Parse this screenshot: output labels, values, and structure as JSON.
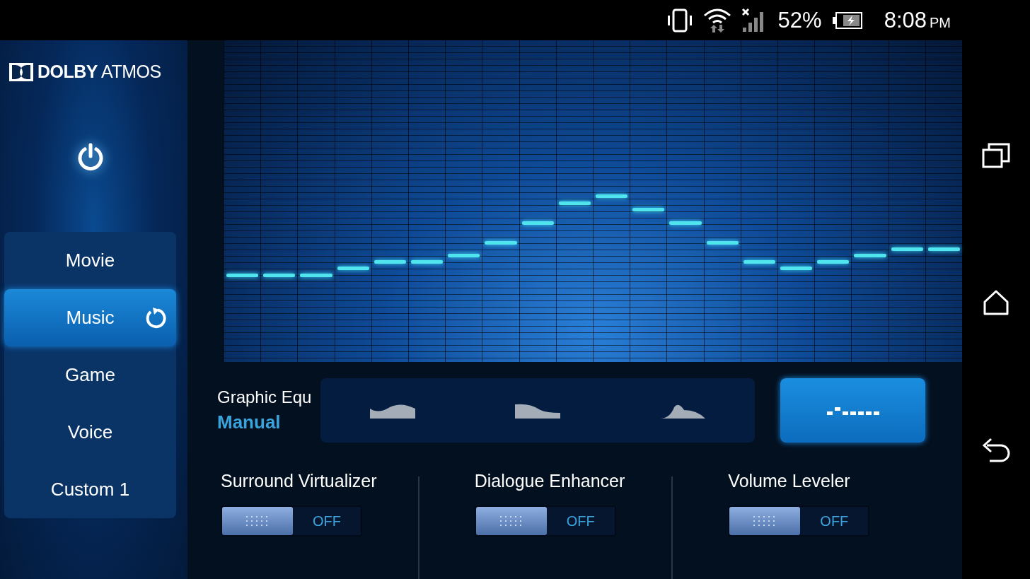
{
  "status_bar": {
    "battery": "52%",
    "time": "8:08",
    "period": "PM"
  },
  "logo": "**DOLBY** ATMOS",
  "power": {
    "on": true
  },
  "profiles": [
    {
      "label": "Movie",
      "selected": false
    },
    {
      "label": "Music",
      "selected": true
    },
    {
      "label": "Game",
      "selected": false
    },
    {
      "label": "Voice",
      "selected": false
    },
    {
      "label": "Custom 1",
      "selected": false
    }
  ],
  "equalizer": {
    "bands": [
      {
        "level": 0.264
      },
      {
        "level": 0.264
      },
      {
        "level": 0.264
      },
      {
        "level": 0.286
      },
      {
        "level": 0.305
      },
      {
        "level": 0.305
      },
      {
        "level": 0.325
      },
      {
        "level": 0.365
      },
      {
        "level": 0.426
      },
      {
        "level": 0.488
      },
      {
        "level": 0.51
      },
      {
        "level": 0.468
      },
      {
        "level": 0.426
      },
      {
        "level": 0.365
      },
      {
        "level": 0.305
      },
      {
        "level": 0.286
      },
      {
        "level": 0.305
      },
      {
        "level": 0.325
      },
      {
        "level": 0.345
      },
      {
        "level": 0.345
      }
    ]
  },
  "graphic_eq": {
    "title": "Graphic Equ",
    "mode": "Manual",
    "presets": [
      {
        "selected": false
      },
      {
        "selected": false
      },
      {
        "selected": false
      }
    ],
    "manual": {
      "selected": true
    }
  },
  "features": [
    {
      "label": "Surround Virtualizer",
      "on": false,
      "switch_text": "OFF"
    },
    {
      "label": "Dialogue Enhancer",
      "on": false,
      "switch_text": "OFF"
    },
    {
      "label": "Volume Leveler",
      "on": false,
      "switch_text": "OFF"
    }
  ]
}
